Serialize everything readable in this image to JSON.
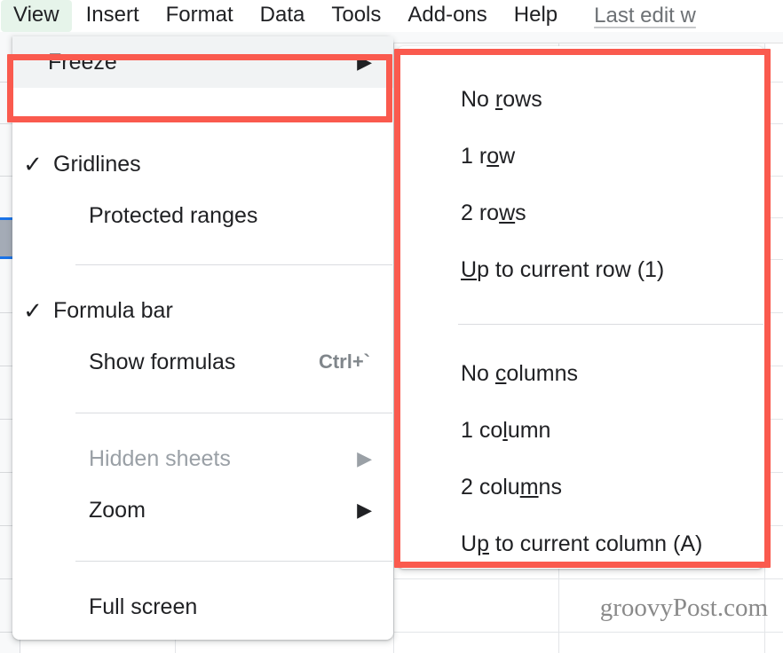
{
  "menubar": {
    "tabs": [
      {
        "label": "View",
        "active": true
      },
      {
        "label": "Insert",
        "active": false
      },
      {
        "label": "Format",
        "active": false
      },
      {
        "label": "Data",
        "active": false
      },
      {
        "label": "Tools",
        "active": false
      },
      {
        "label": "Add-ons",
        "active": false
      },
      {
        "label": "Help",
        "active": false
      }
    ],
    "last_edit": "Last edit w",
    "active_tab_bg": "#e6f4ea"
  },
  "view_menu": {
    "items": [
      {
        "label": "Freeze",
        "checked": false,
        "arrow": "▶",
        "accel": "",
        "disabled": false,
        "highlighted": true
      },
      {
        "label": "Gridlines",
        "checked": true,
        "arrow": "",
        "accel": "",
        "disabled": false,
        "highlighted": false
      },
      {
        "label": "Protected ranges",
        "checked": false,
        "arrow": "",
        "accel": "",
        "disabled": false,
        "highlighted": false
      },
      {
        "label": "Formula bar",
        "checked": true,
        "arrow": "",
        "accel": "",
        "disabled": false,
        "highlighted": false
      },
      {
        "label": "Show formulas",
        "checked": false,
        "arrow": "",
        "accel": "Ctrl+`",
        "disabled": false,
        "highlighted": false
      },
      {
        "label": "Hidden sheets",
        "checked": false,
        "arrow": "▶",
        "accel": "",
        "disabled": true,
        "highlighted": false
      },
      {
        "label": "Zoom",
        "checked": false,
        "arrow": "▶",
        "accel": "",
        "disabled": false,
        "highlighted": false
      },
      {
        "label": "Full screen",
        "checked": false,
        "arrow": "",
        "accel": "",
        "disabled": false,
        "highlighted": false
      }
    ],
    "checkmark": "✓"
  },
  "freeze_submenu": {
    "rows": [
      {
        "pre": "No ",
        "acc": "r",
        "post": "ows",
        "full": "No rows"
      },
      {
        "pre": "1 r",
        "acc": "o",
        "post": "w",
        "full": "1 row"
      },
      {
        "pre": "2 ro",
        "acc": "w",
        "post": "s",
        "full": "2 rows"
      },
      {
        "pre": "",
        "acc": "U",
        "post": "p to current row (1)",
        "full": "Up to current row (1)"
      }
    ],
    "columns": [
      {
        "pre": "No ",
        "acc": "c",
        "post": "olumns",
        "full": "No columns"
      },
      {
        "pre": "1 co",
        "acc": "l",
        "post": "umn",
        "full": "1 column"
      },
      {
        "pre": "2 colu",
        "acc": "m",
        "post": "ns",
        "full": "2 columns"
      },
      {
        "pre": "U",
        "acc": "p",
        "post": " to current column (A)",
        "full": "Up to current column (A)"
      }
    ]
  },
  "annotations": {
    "highlight_color": "#fa5a4e",
    "boxes": [
      {
        "name": "freeze-item-highlight"
      },
      {
        "name": "freeze-submenu-highlight"
      }
    ]
  },
  "watermark": {
    "text": "groovyPost.com"
  }
}
